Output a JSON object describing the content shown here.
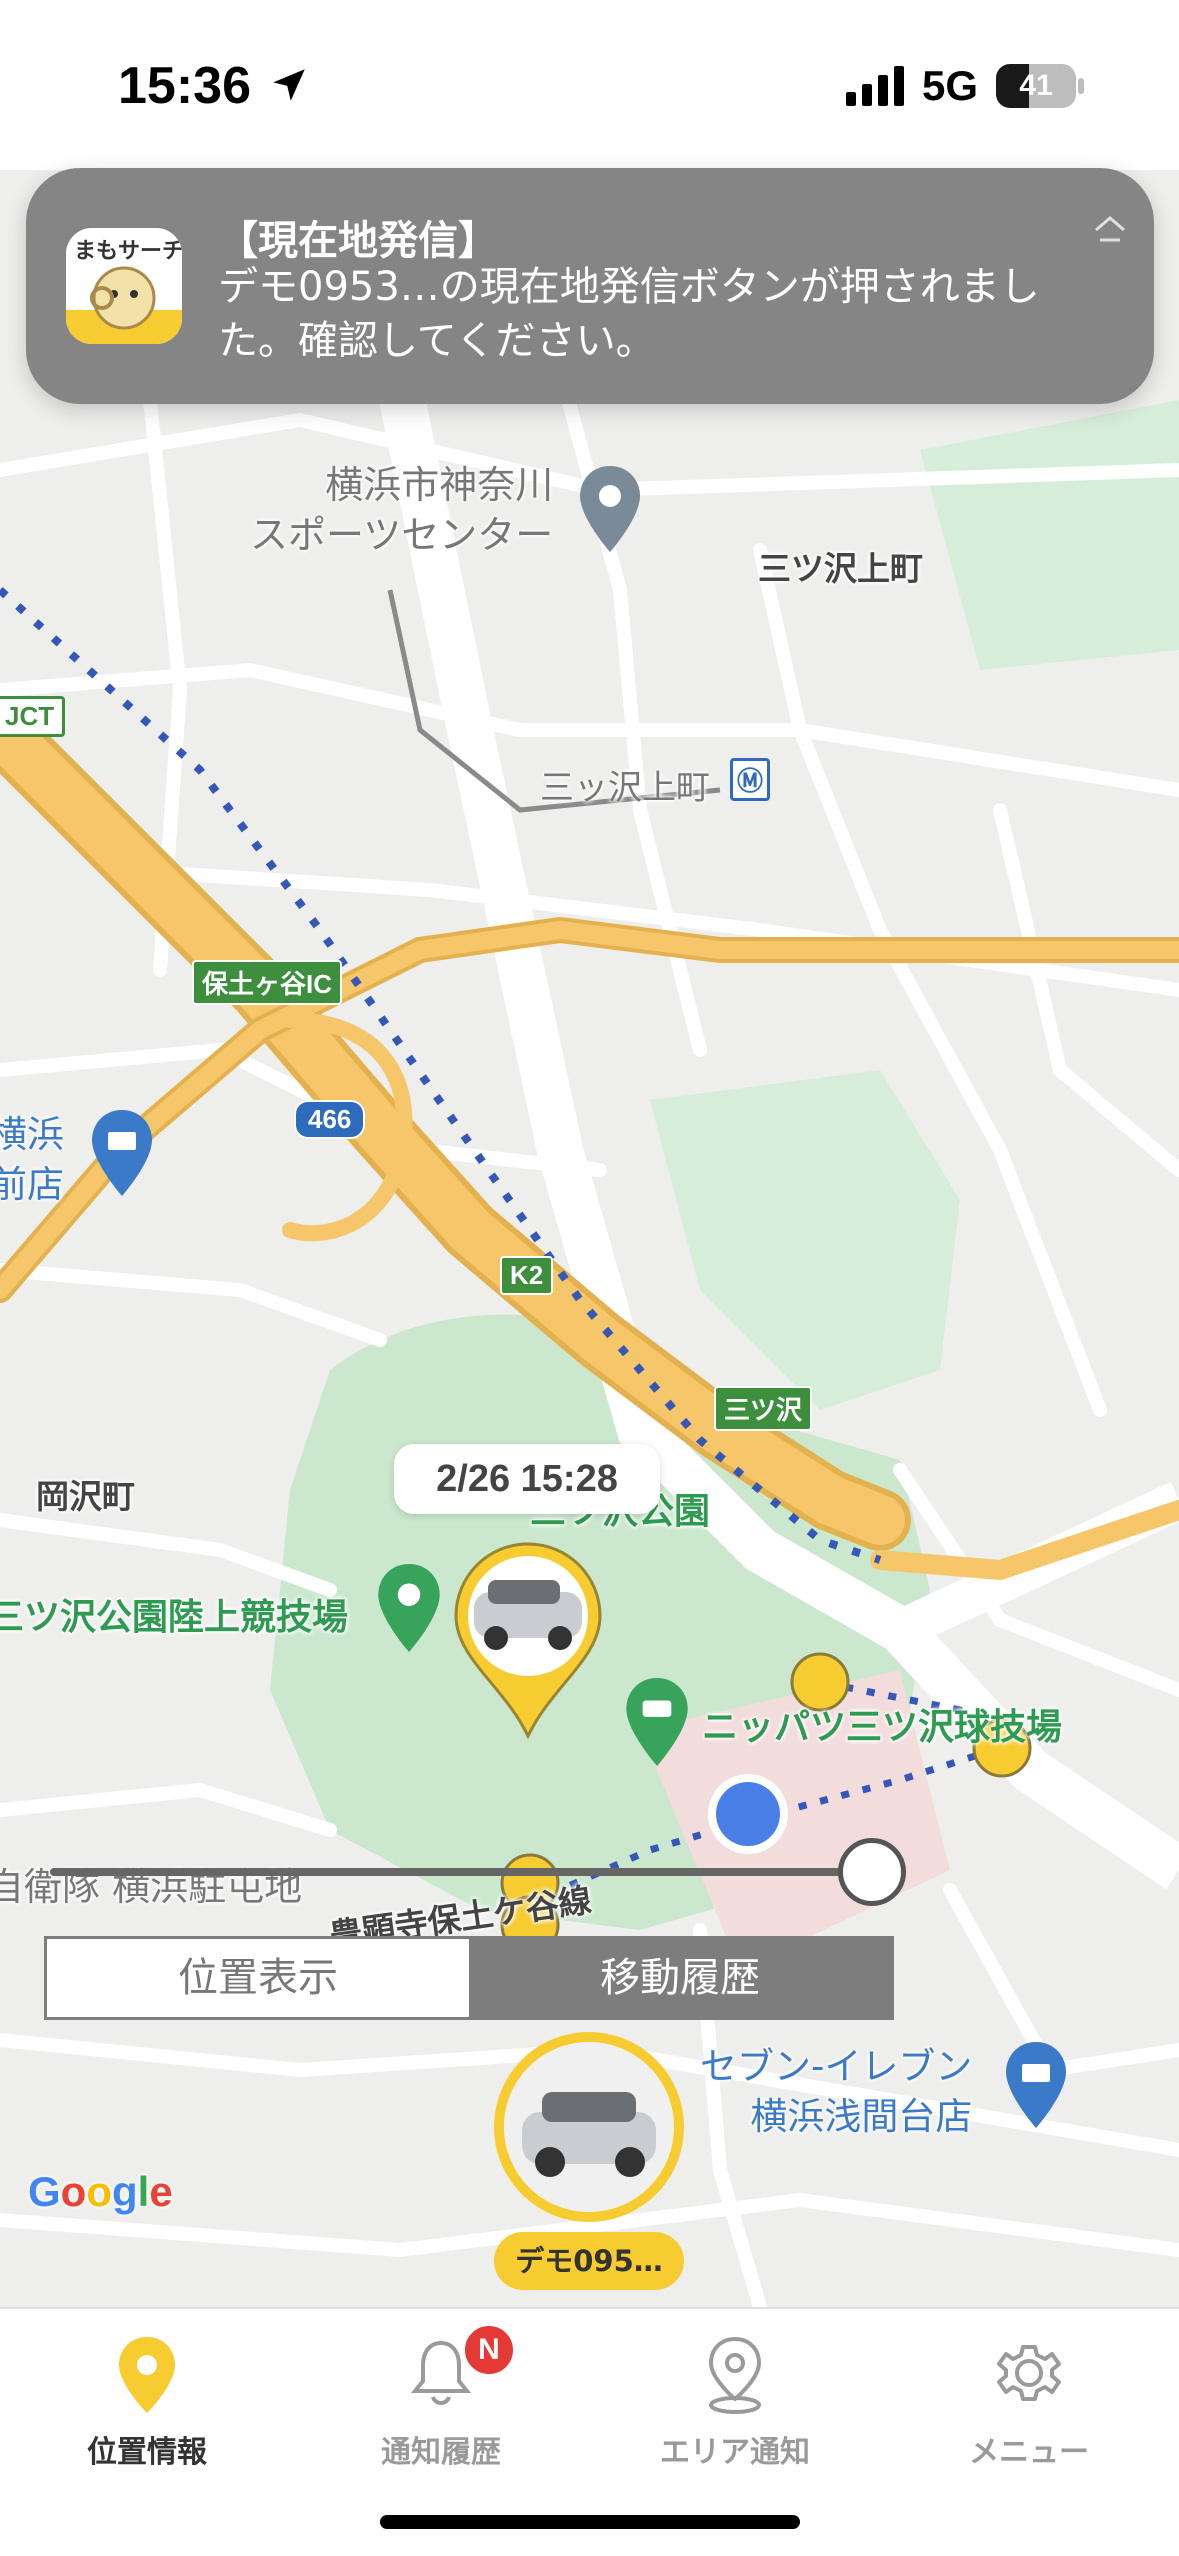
{
  "status_bar": {
    "time": "15:36",
    "network": "5G",
    "battery": "41",
    "battery_level": 0.41
  },
  "notification": {
    "title": "【現在地発信】",
    "body": "デモ0953…の現在地発信ボタンが押されました。確認してください。",
    "expand_glyph": "⇡"
  },
  "map": {
    "labels": {
      "sports_center": "横浜市神奈川\nスポーツセンター",
      "mitsuzawa_kamicho": "三ツ沢上町",
      "station": "三ッ沢上町",
      "jct": "JCT",
      "hodogaya_ic": "保土ヶ谷IC",
      "route466": "466",
      "k2": "K2",
      "mitsuzawa_sign": "三ツ沢",
      "okazawa": "岡沢町",
      "park": "三ツ沢公園",
      "stadium": "三ツ沢公園陸上競技場",
      "nippatsu": "ニッパツ三ツ沢球技場",
      "road": "豊顕寺保土ケ谷線",
      "sdf": "自衛隊 横浜駐屯地",
      "yokohama_store": "横浜\n前店",
      "seven": "セブン-イレブン\n横浜浅間台店"
    },
    "time_bubble": "2/26 15:28",
    "google": "Google"
  },
  "history_slider": {
    "position": 1.0
  },
  "segmented": {
    "location": "位置表示",
    "history": "移動履歴",
    "selected": "history"
  },
  "device": {
    "name": "デモ095…"
  },
  "tabs": [
    {
      "label": "位置情報",
      "icon": "map-pin-icon",
      "active": true
    },
    {
      "label": "通知履歴",
      "icon": "bell-icon",
      "badge": "N"
    },
    {
      "label": "エリア通知",
      "icon": "area-pin-icon"
    },
    {
      "label": "メニュー",
      "icon": "gear-icon"
    }
  ],
  "colors": {
    "accent": "#f6cc30",
    "route_dots": "#3557b8",
    "current_location": "#4a7fe8",
    "park": "#cbe8cf",
    "highway": "#f5c66a"
  }
}
